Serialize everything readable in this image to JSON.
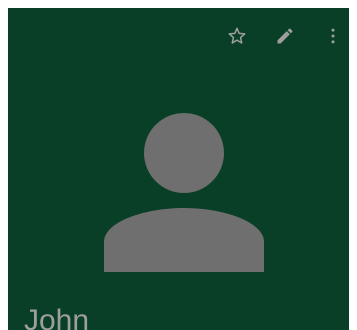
{
  "header": {
    "background_color": "#0a3f27",
    "icon_color": "#9e9e9e",
    "actions": [
      {
        "name": "favorite",
        "icon": "star-outline-icon"
      },
      {
        "name": "edit",
        "icon": "pencil-icon"
      },
      {
        "name": "more-options",
        "icon": "more-vert-icon"
      }
    ]
  },
  "avatar": {
    "icon": "person-placeholder-icon",
    "color": "#6f6f6f"
  },
  "contact": {
    "name": "John"
  }
}
